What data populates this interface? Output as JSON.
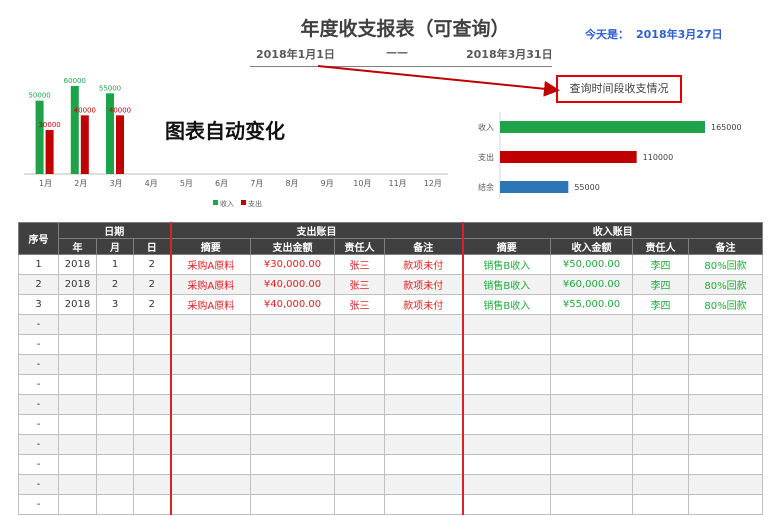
{
  "header": {
    "title": "年度收支报表（可查询）",
    "today_label": "今天是：",
    "today_value": "2018年3月27日",
    "date_start": "2018年1月1日",
    "date_sep": "——",
    "date_end": "2018年3月31日",
    "annotation": "查询时间段收支情况",
    "chart_caption": "图表自动变化"
  },
  "colors": {
    "income": "#1fa34a",
    "expense": "#c00000",
    "balance": "#2e75b6",
    "accent_red": "#e02020",
    "header_bg": "#404040"
  },
  "chart_data": [
    {
      "type": "bar",
      "categories": [
        "1月",
        "2月",
        "3月",
        "4月",
        "5月",
        "6月",
        "7月",
        "8月",
        "9月",
        "10月",
        "11月",
        "12月"
      ],
      "series": [
        {
          "name": "收入",
          "values": [
            50000,
            60000,
            55000,
            null,
            null,
            null,
            null,
            null,
            null,
            null,
            null,
            null
          ]
        },
        {
          "name": "支出",
          "values": [
            30000,
            40000,
            40000,
            null,
            null,
            null,
            null,
            null,
            null,
            null,
            null,
            null
          ]
        }
      ],
      "ylim": [
        0,
        60000
      ],
      "legend": "bottom",
      "grid": false
    },
    {
      "type": "bar",
      "orientation": "horizontal",
      "categories": [
        "收入",
        "支出",
        "结余"
      ],
      "values": [
        165000,
        110000,
        55000
      ],
      "xlim": [
        0,
        165000
      ],
      "grid": false
    }
  ],
  "table": {
    "group_headers": {
      "seq": "序号",
      "date": "日期",
      "expense": "支出账目",
      "income": "收入账目"
    },
    "sub_headers": [
      "年",
      "月",
      "日",
      "摘要",
      "支出金额",
      "责任人",
      "备注",
      "摘要",
      "收入金额",
      "责任人",
      "备注"
    ],
    "rows": [
      {
        "seq": "1",
        "year": "2018",
        "month": "1",
        "day": "2",
        "exp_desc": "采购A原料",
        "exp_amount": "¥30,000.00",
        "exp_person": "张三",
        "exp_note": "款项未付",
        "inc_desc": "销售B收入",
        "inc_amount": "¥50,000.00",
        "inc_person": "李四",
        "inc_note": "80%回款"
      },
      {
        "seq": "2",
        "year": "2018",
        "month": "2",
        "day": "2",
        "exp_desc": "采购A原料",
        "exp_amount": "¥40,000.00",
        "exp_person": "张三",
        "exp_note": "款项未付",
        "inc_desc": "销售B收入",
        "inc_amount": "¥60,000.00",
        "inc_person": "李四",
        "inc_note": "80%回款"
      },
      {
        "seq": "3",
        "year": "2018",
        "month": "3",
        "day": "2",
        "exp_desc": "采购A原料",
        "exp_amount": "¥40,000.00",
        "exp_person": "张三",
        "exp_note": "款项未付",
        "inc_desc": "销售B收入",
        "inc_amount": "¥55,000.00",
        "inc_person": "李四",
        "inc_note": "80%回款"
      },
      {
        "seq": "-"
      },
      {
        "seq": "-"
      },
      {
        "seq": "-"
      },
      {
        "seq": "-"
      },
      {
        "seq": "-"
      },
      {
        "seq": "-"
      },
      {
        "seq": "-"
      },
      {
        "seq": "-"
      },
      {
        "seq": "-"
      },
      {
        "seq": "-"
      }
    ]
  }
}
